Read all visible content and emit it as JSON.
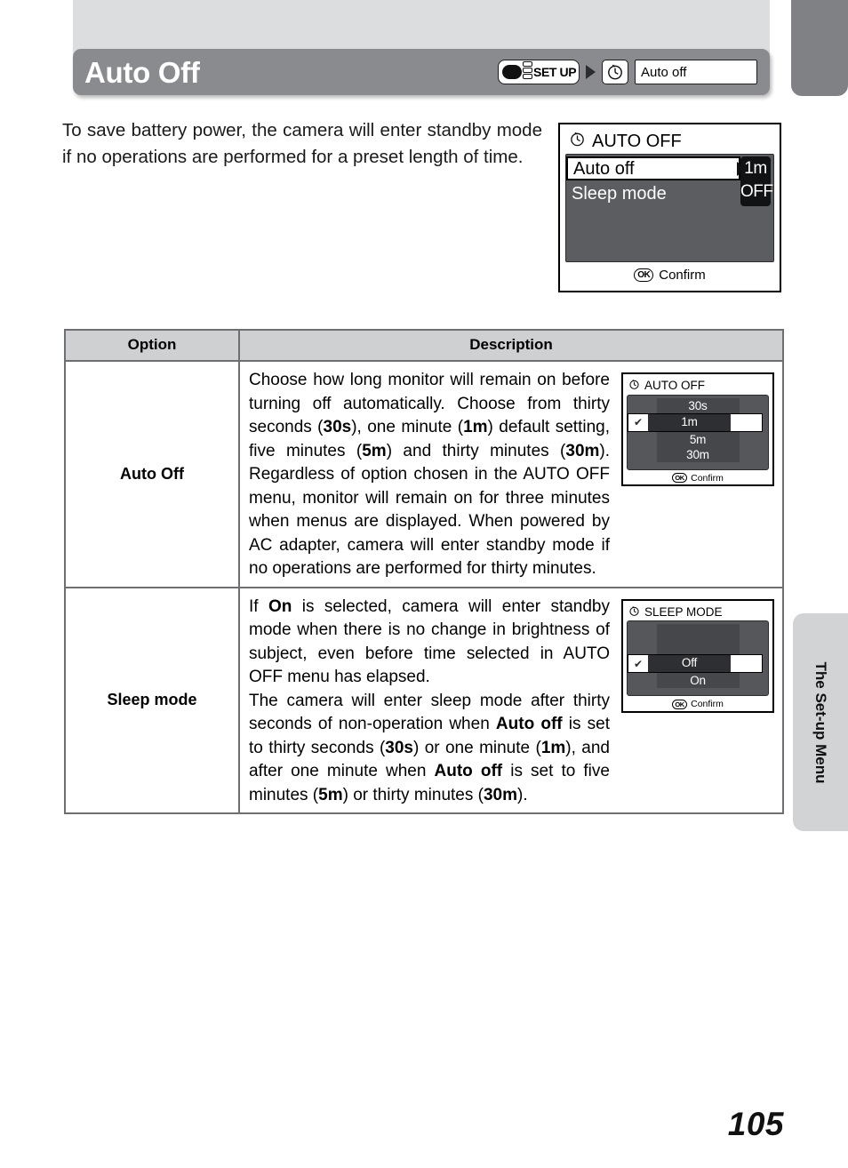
{
  "header": {
    "title": "Auto Off",
    "breadcrumb": {
      "mode_label": "SET UP",
      "clock_icon": "clock-icon",
      "arrow_icon": "breadcrumb-arrow-icon",
      "menu_item": "Auto off"
    }
  },
  "intro": "To save battery power, the camera will enter standby mode if no operations are performed for a preset length of time.",
  "lcd_main": {
    "title": "AUTO OFF",
    "title_icon": "clock-icon",
    "rows": [
      {
        "label": "Auto off",
        "value": "1m",
        "selected": true
      },
      {
        "label": "Sleep mode",
        "value": "OFF",
        "selected": false
      }
    ],
    "confirm_badge": "OK",
    "confirm_label": "Confirm"
  },
  "table": {
    "headers": {
      "option": "Option",
      "description": "Description"
    },
    "rows": [
      {
        "option": "Auto Off",
        "description": "Choose how long monitor will remain on before turning off automatically. Choose from thirty seconds (30s), one minute (1m) default setting, five minutes (5m) and thirty minutes (30m). Regardless of option chosen in the AUTO OFF menu, monitor will remain on for three minutes when menus are displayed. When powered by AC adapter, camera will enter standby mode if no operations are performed for thirty minutes.",
        "lcd": {
          "title": "AUTO OFF",
          "title_icon": "clock-icon",
          "items": [
            "30s",
            "1m",
            "5m",
            "30m"
          ],
          "selected": "1m",
          "selected_index": 1,
          "check_glyph": "✔",
          "confirm_badge": "OK",
          "confirm_label": "Confirm"
        }
      },
      {
        "option": "Sleep mode",
        "description": "If On is selected, camera will enter standby mode when there is no change in brightness of subject, even before time selected in AUTO OFF menu has elapsed. The camera will enter sleep mode after thirty seconds of non-operation when Auto off is set to thirty seconds (30s) or one minute (1m), and after one minute when Auto off is set to five minutes (5m) or thirty minutes (30m).",
        "lcd": {
          "title": "SLEEP MODE",
          "title_icon": "clock-icon",
          "items": [
            "Off",
            "On"
          ],
          "selected": "Off",
          "selected_index": 0,
          "check_glyph": "✔",
          "confirm_badge": "OK",
          "confirm_label": "Confirm"
        }
      }
    ]
  },
  "side_tab": {
    "label": "The Set-up Menu"
  },
  "page_number": "105",
  "colors": {
    "title_bar": "#8a8b8f",
    "top_strip": "#dcdddf",
    "corner_tab": "#808185",
    "table_header": "#cfd0d2",
    "table_border": "#6e6f73",
    "lcd_body": "#5c5d61",
    "side_tab": "#d2d3d5"
  }
}
